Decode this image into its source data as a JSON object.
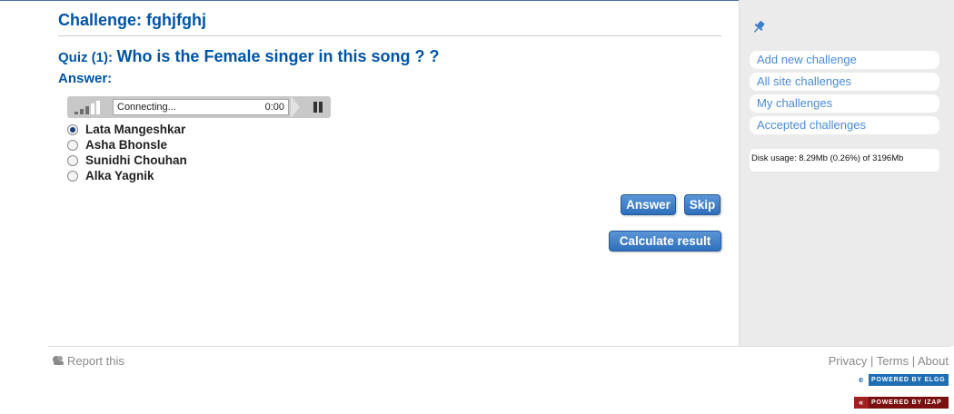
{
  "challenge": {
    "title": "Challenge: fghjfghj"
  },
  "quiz": {
    "label": "Quiz (1):",
    "question": "Who is the Female singer in this song ? ?",
    "answer_label": "Answer:"
  },
  "player": {
    "status": "Connecting...",
    "time": "0:00",
    "volume_bars": 5,
    "volume_level": 3
  },
  "options": [
    {
      "label": "Lata Mangeshkar",
      "selected": true
    },
    {
      "label": "Asha Bhonsle",
      "selected": false
    },
    {
      "label": "Sunidhi Chouhan",
      "selected": false
    },
    {
      "label": "Alka Yagnik",
      "selected": false
    }
  ],
  "buttons": {
    "answer": "Answer",
    "skip": "Skip",
    "calculate": "Calculate result"
  },
  "sidebar": {
    "menu": [
      "Add new challenge",
      "All site challenges",
      "My challenges",
      "Accepted challenges"
    ],
    "disk_usage": "Disk usage: 8.29Mb (0.26%) of 3196Mb"
  },
  "footer": {
    "report": "Report this",
    "links": [
      "Privacy",
      "Terms",
      "About"
    ],
    "separator": " | ",
    "badge_elgg": "POWERED BY ELGG",
    "badge_izap": "POWERED BY IZAP"
  },
  "colors": {
    "title_blue": "#0054a7",
    "button_blue": "#2f6fbb",
    "sidebar_bg": "#ebebeb",
    "link_blue": "#4a8bd8"
  }
}
